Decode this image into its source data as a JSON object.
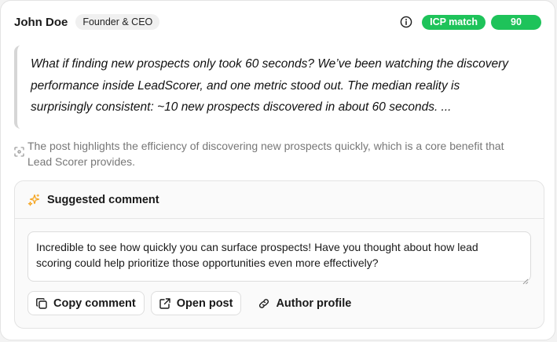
{
  "post": {
    "author_name": "John Doe",
    "author_role": "Founder & CEO",
    "icp_label": "ICP match",
    "score": "90",
    "quote_lines": [
      "What if finding new prospects only took 60 seconds? We’ve been watching the discovery",
      "performance inside LeadScorer, and one metric stood out. The median reality is",
      "surprisingly consistent: ~10 new prospects discovered in about 60 seconds. ..."
    ],
    "insight_lines": [
      "The post highlights the efficiency of discovering new prospects quickly, which is a core benefit that",
      "Lead Scorer provides."
    ]
  },
  "suggestion": {
    "title": "Suggested comment",
    "comment_lines": [
      "Incredible to see how quickly you can surface prospects! Have you thought about how lead",
      "scoring could help prioritize those opportunities even more effectively?"
    ]
  },
  "actions": {
    "copy_label": "Copy comment",
    "open_label": "Open post",
    "profile_label": "Author profile"
  },
  "colors": {
    "accent_green": "#1ec35a",
    "sparkle_orange": "#f5a623"
  },
  "icons": [
    "info-icon",
    "scan-icon",
    "sparkle-icon",
    "copy-icon",
    "external-link-icon",
    "link-icon"
  ]
}
